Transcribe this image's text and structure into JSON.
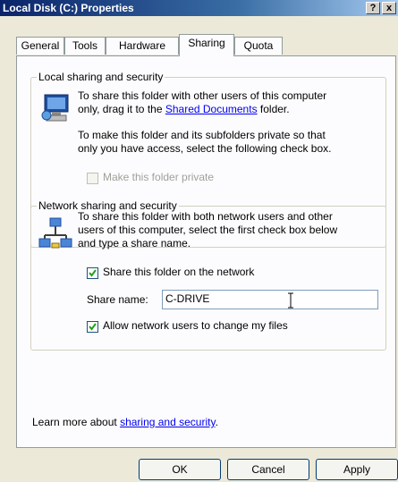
{
  "window": {
    "title": "Local Disk (C:) Properties",
    "help_button": "?",
    "close_button": "x"
  },
  "tabs": [
    {
      "label": "General"
    },
    {
      "label": "Tools"
    },
    {
      "label": "Hardware"
    },
    {
      "label": "Sharing",
      "active": true
    },
    {
      "label": "Quota"
    }
  ],
  "local": {
    "legend": "Local sharing and security",
    "para1_line1": "To share this folder with other users of this computer",
    "para1_line2_pre": "only, drag it to the ",
    "para1_link": "Shared Documents",
    "para1_line2_post": " folder.",
    "para2_line1": "To make this folder and its subfolders private so that",
    "para2_line2": "only you have access, select the following check box.",
    "private_label": "Make this folder private",
    "private_checked": false
  },
  "network": {
    "legend": "Network sharing and security",
    "para_line1": "To share this folder with both network users and other",
    "para_line2": "users of this computer, select the first check box below",
    "para_line3": "and type a share name.",
    "share_label": "Share this folder on the network",
    "share_checked": true,
    "share_name_label": "Share name:",
    "share_name_value": "C-DRIVE",
    "allow_label": "Allow network users to change my files",
    "allow_checked": true
  },
  "learn": {
    "prefix": "Learn more about ",
    "link": "sharing and security",
    "suffix": "."
  },
  "buttons": {
    "ok": "OK",
    "cancel": "Cancel",
    "apply": "Apply"
  }
}
